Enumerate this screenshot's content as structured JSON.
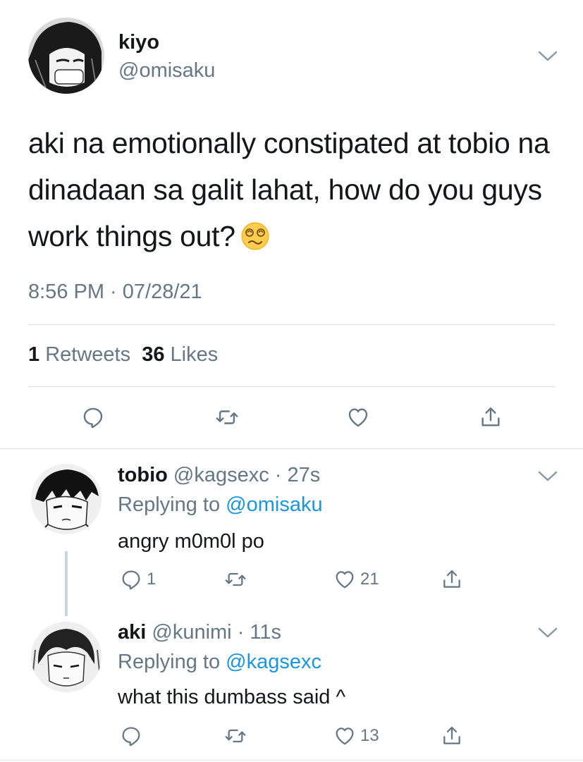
{
  "main_tweet": {
    "name": "kiyo",
    "handle": "@omisaku",
    "text": "aki na emotionally constipated at tobio na dinadaan sa galit lahat, how do you guys work things out?",
    "emoji": "dizzy-face-emoji",
    "timestamp": "8:56 PM · 07/28/21",
    "retweets_count": "1",
    "retweets_label": "Retweets",
    "likes_count": "36",
    "likes_label": "Likes"
  },
  "replies": [
    {
      "name": "tobio",
      "handle": "@kagsexc",
      "time": "27s",
      "replying_prefix": "Replying to",
      "replying_to": "@omisaku",
      "text": "angry m0m0l po",
      "reply_count": "1",
      "retweet_count": "",
      "like_count": "21"
    },
    {
      "name": "aki",
      "handle": "@kunimi",
      "time": "11s",
      "replying_prefix": "Replying to",
      "replying_to": "@kagsexc",
      "text": "what this dumbass said ^",
      "reply_count": "",
      "retweet_count": "",
      "like_count": "13"
    }
  ],
  "colors": {
    "text": "#14171a",
    "secondary": "#657786",
    "link": "#1b95e0",
    "divider": "#dfe3e6"
  }
}
